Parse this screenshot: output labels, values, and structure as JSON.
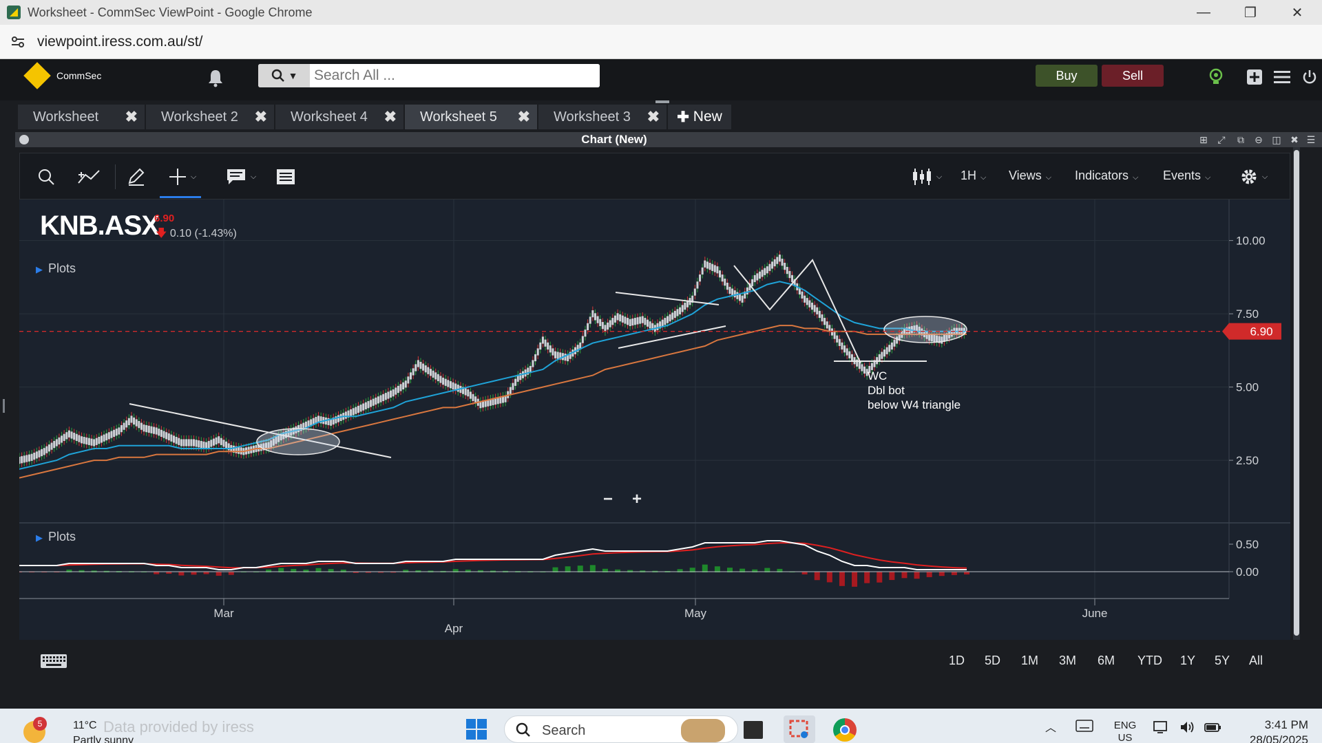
{
  "browser": {
    "title": "Worksheet - CommSec ViewPoint - Google Chrome",
    "url": "viewpoint.iress.com.au/st/",
    "controls": {
      "minimize": "—",
      "restore": "❐",
      "close": "✕"
    }
  },
  "app": {
    "brand": "CommSec",
    "search_placeholder": "Search All ...",
    "buy_label": "Buy",
    "sell_label": "Sell"
  },
  "worksheet_tabs": [
    {
      "label": "Worksheet",
      "active": false
    },
    {
      "label": "Worksheet 2",
      "active": false
    },
    {
      "label": "Worksheet 4",
      "active": false
    },
    {
      "label": "Worksheet 5",
      "active": true
    },
    {
      "label": "Worksheet 3",
      "active": false
    }
  ],
  "new_tab_label": "New",
  "panel": {
    "title": "Chart (New)"
  },
  "chart_toolbar": {
    "interval": "1H",
    "views": "Views",
    "indicators": "Indicators",
    "events": "Events"
  },
  "instrument": {
    "symbol": "KNB.ASX",
    "price": "6.90",
    "change": "0.10 (-1.43%)",
    "price_tag": "6.90"
  },
  "plots_label": "Plots",
  "annotation": {
    "line1": "WC",
    "line2": "Dbl bot",
    "line3": "below W4 triangle"
  },
  "zoom": {
    "minus": "−",
    "plus": "+"
  },
  "range_buttons": [
    "1D",
    "5D",
    "1M",
    "3M",
    "6M",
    "YTD",
    "1Y",
    "5Y",
    "All"
  ],
  "taskbar": {
    "weather_badge": "5",
    "temperature": "11°C",
    "condition": "Partly sunny",
    "watermark": "Data provided by iress",
    "search": "Search",
    "lang_top": "ENG",
    "lang_bottom": "US",
    "time": "3:41 PM",
    "date": "28/05/2025"
  },
  "colors": {
    "price_series": "#c8c8c8",
    "ma_fast": "#1fa3d8",
    "ma_slow": "#d9773f",
    "macd_line": "#ffffff",
    "signal_line": "#e02020",
    "hist_up": "#1f9a2b",
    "hist_down": "#c0181e",
    "current_price": "#d02a2a"
  },
  "chart_data": {
    "type": "line",
    "x_ticks": [
      "Mar",
      "Apr",
      "May",
      "June"
    ],
    "y_ticks": [
      "2.50",
      "5.00",
      "7.50",
      "10.00"
    ],
    "ylim": [
      0.6,
      11.4
    ],
    "macd_ticks": [
      "0.50",
      "0.00"
    ],
    "current_price": 6.9,
    "series": [
      {
        "values": [
          2.5,
          2.6,
          2.8,
          3.1,
          3.4,
          3.2,
          3.1,
          3.3,
          3.5,
          3.9,
          3.6,
          3.5,
          3.3,
          3.1,
          3.1,
          3.0,
          3.2,
          2.9,
          2.8,
          2.9,
          3.0,
          3.3,
          3.5,
          3.7,
          3.9,
          3.8,
          4.0,
          4.2,
          4.4,
          4.6,
          4.8,
          5.1,
          5.8,
          5.5,
          5.2,
          5.0,
          4.8,
          4.4,
          4.5,
          4.6,
          5.3,
          5.6,
          6.6,
          6.1,
          6.0,
          6.4,
          7.5,
          7.0,
          7.4,
          7.2,
          7.3,
          7.0,
          7.3,
          7.6,
          8.0,
          9.2,
          9.0,
          8.3,
          8.0,
          8.7,
          9.0,
          9.4,
          8.7,
          8.0,
          7.6,
          7.0,
          6.4,
          5.9,
          5.5,
          6.0,
          6.4,
          6.9,
          7.0,
          6.7,
          6.6,
          6.9,
          6.9
        ]
      },
      {
        "values": [
          2.2,
          2.3,
          2.4,
          2.5,
          2.7,
          2.8,
          2.9,
          2.9,
          3.0,
          3.0,
          3.0,
          3.0,
          3.0,
          2.9,
          2.9,
          2.9,
          2.9,
          2.9,
          3.0,
          3.1,
          3.2,
          3.4,
          3.5,
          3.6,
          3.8,
          3.9,
          4.0,
          4.0,
          4.1,
          4.2,
          4.3,
          4.5,
          4.6,
          4.7,
          4.8,
          4.9,
          5.0,
          5.1,
          5.2,
          5.3,
          5.4,
          5.5,
          5.6,
          5.9,
          6.1,
          6.3,
          6.5,
          6.6,
          6.7,
          6.8,
          6.9,
          7.0,
          7.1,
          7.3,
          7.5,
          7.8,
          8.0,
          8.1,
          8.2,
          8.3,
          8.5,
          8.6,
          8.5,
          8.3,
          8.0,
          7.7,
          7.4,
          7.2,
          7.1,
          7.0,
          7.0,
          7.0,
          6.9,
          6.9,
          6.9,
          6.9,
          6.9
        ]
      },
      {
        "values": [
          1.9,
          2.0,
          2.1,
          2.2,
          2.3,
          2.4,
          2.5,
          2.5,
          2.6,
          2.6,
          2.6,
          2.7,
          2.7,
          2.7,
          2.7,
          2.7,
          2.8,
          2.8,
          2.8,
          2.9,
          2.9,
          3.0,
          3.1,
          3.2,
          3.3,
          3.4,
          3.5,
          3.6,
          3.7,
          3.8,
          3.9,
          4.0,
          4.1,
          4.2,
          4.3,
          4.3,
          4.4,
          4.5,
          4.6,
          4.7,
          4.8,
          4.9,
          5.0,
          5.1,
          5.2,
          5.3,
          5.4,
          5.6,
          5.7,
          5.8,
          5.9,
          6.0,
          6.1,
          6.2,
          6.3,
          6.4,
          6.6,
          6.7,
          6.8,
          6.9,
          7.0,
          7.1,
          7.1,
          7.0,
          7.0,
          6.9,
          6.9,
          6.9,
          6.8,
          6.8,
          6.8,
          6.8,
          6.8,
          6.8,
          6.8,
          6.8,
          6.8
        ]
      }
    ]
  }
}
